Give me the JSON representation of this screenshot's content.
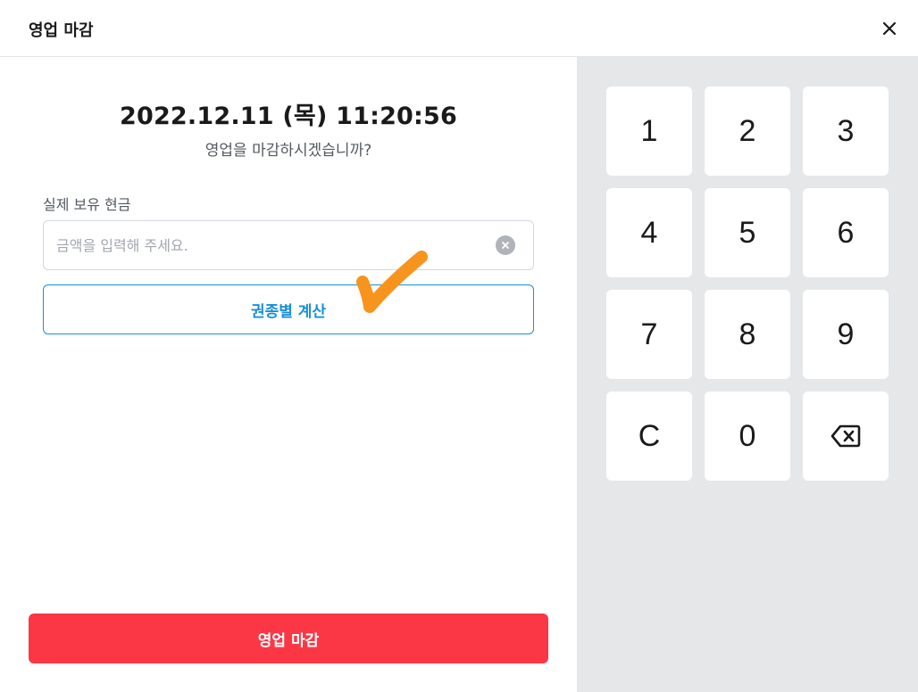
{
  "header": {
    "title": "영업 마감",
    "close_icon": "close-icon"
  },
  "main": {
    "datetime": "2022.12.11 (목) 11:20:56",
    "question": "영업을 마감하시겠습니까?",
    "cash_label": "실제 보유 현금",
    "amount_value": "",
    "amount_placeholder": "금액을 입력해 주세요.",
    "clear_icon": "clear-circle-icon",
    "denomination_button": "권종별 계산",
    "close_business_button": "영업 마감"
  },
  "keypad": {
    "keys": [
      "1",
      "2",
      "3",
      "4",
      "5",
      "6",
      "7",
      "8",
      "9",
      "C",
      "0"
    ],
    "backspace_icon": "backspace-icon"
  },
  "colors": {
    "accent_blue": "#1a8fd8",
    "primary_red": "#fb3746",
    "keypad_bg": "#e6e7e9",
    "checkmark_orange": "#f7941d"
  }
}
